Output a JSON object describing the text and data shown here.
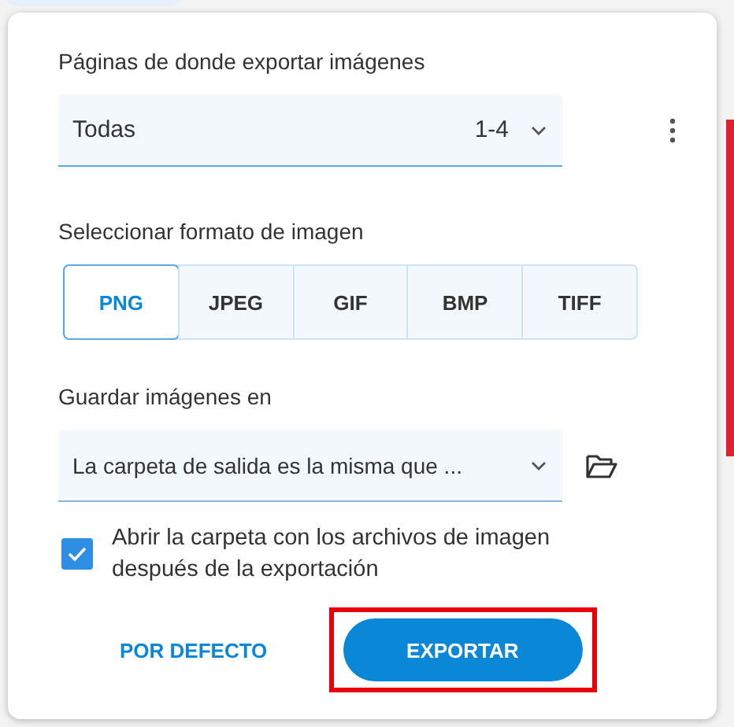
{
  "pages": {
    "label": "Páginas de donde exportar imágenes",
    "value": "Todas",
    "range": "1-4"
  },
  "format": {
    "label": "Seleccionar formato de imagen",
    "options": [
      {
        "label": "PNG",
        "selected": true
      },
      {
        "label": "JPEG",
        "selected": false
      },
      {
        "label": "GIF",
        "selected": false
      },
      {
        "label": "BMP",
        "selected": false
      },
      {
        "label": "TIFF",
        "selected": false
      }
    ]
  },
  "save": {
    "label": "Guardar imágenes en",
    "value": "La carpeta de salida es la misma que ..."
  },
  "open_folder": {
    "label": "Abrir la carpeta con los archivos de imagen después de la exportación",
    "checked": true
  },
  "buttons": [
    {
      "label": "POR DEFECTO",
      "kind": "text",
      "highlighted": false
    },
    {
      "label": "EXPORTAR",
      "kind": "primary",
      "highlighted": true
    }
  ]
}
